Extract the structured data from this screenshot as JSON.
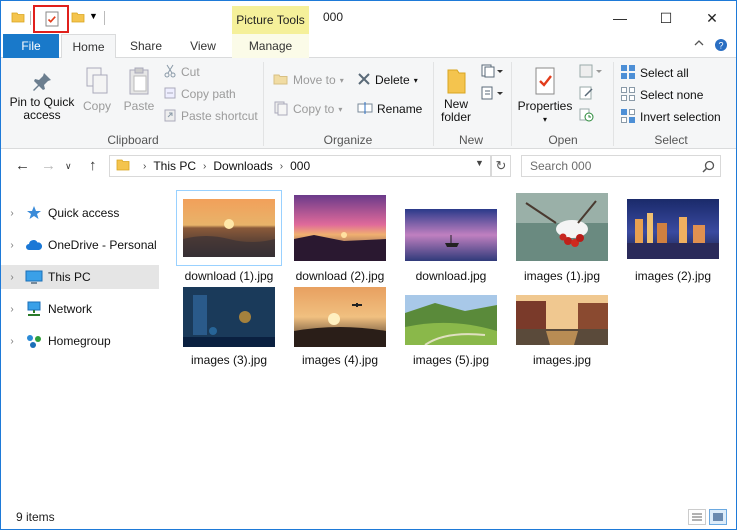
{
  "title_bar": {
    "contextual_tab": "Picture Tools",
    "title": "000",
    "minimize": "—",
    "maximize": "☐",
    "close": "✕"
  },
  "tabs": {
    "file": "File",
    "home": "Home",
    "share": "Share",
    "view": "View",
    "manage": "Manage"
  },
  "ribbon": {
    "clipboard": {
      "group_label": "Clipboard",
      "pin_line1": "Pin to Quick",
      "pin_line2": "access",
      "copy": "Copy",
      "paste": "Paste",
      "cut": "Cut",
      "copy_path": "Copy path",
      "paste_shortcut": "Paste shortcut"
    },
    "organize": {
      "group_label": "Organize",
      "move_to": "Move to",
      "copy_to": "Copy to",
      "delete": "Delete",
      "rename": "Rename"
    },
    "new": {
      "group_label": "New",
      "new_folder_line1": "New",
      "new_folder_line2": "folder"
    },
    "open": {
      "group_label": "Open",
      "properties": "Properties"
    },
    "select": {
      "group_label": "Select",
      "select_all": "Select all",
      "select_none": "Select none",
      "invert_selection": "Invert selection"
    }
  },
  "address": {
    "crumbs": [
      "This PC",
      "Downloads",
      "000"
    ],
    "search_placeholder": "Search 000"
  },
  "sidebar": {
    "items": [
      {
        "label": "Quick access"
      },
      {
        "label": "OneDrive - Personal"
      },
      {
        "label": "This PC"
      },
      {
        "label": "Network"
      },
      {
        "label": "Homegroup"
      }
    ]
  },
  "files": [
    {
      "name": "download (1).jpg"
    },
    {
      "name": "download (2).jpg"
    },
    {
      "name": "download.jpg"
    },
    {
      "name": "images (1).jpg"
    },
    {
      "name": "images (2).jpg"
    },
    {
      "name": "images (3).jpg"
    },
    {
      "name": "images (4).jpg"
    },
    {
      "name": "images (5).jpg"
    },
    {
      "name": "images.jpg"
    }
  ],
  "status": {
    "item_count": "9 items"
  },
  "colors": {
    "accent": "#1979ca",
    "picture_tools": "#f5f09a",
    "highlight_box": "#e0201c",
    "selected_nav": "#e5e5e5"
  }
}
